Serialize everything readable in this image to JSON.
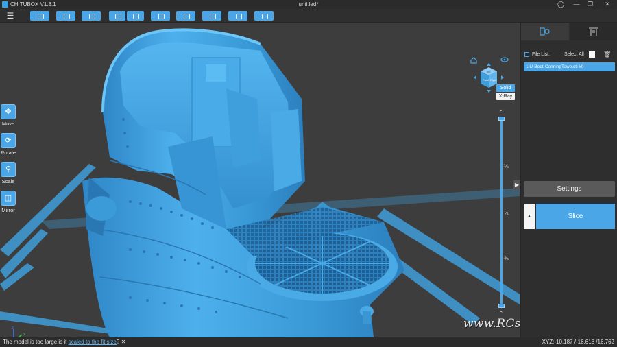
{
  "titlebar": {
    "app_name": "CHITUBOX V1.8.1",
    "document": "untitled*",
    "user_icon": "user-icon",
    "minimize_icon": "minimize-icon",
    "restore_icon": "restore-icon",
    "close_icon": "close-icon"
  },
  "toolbar": {
    "menu_icon": "hamburger-menu-icon",
    "buttons": [
      "open-file-icon",
      "save-file-dropdown-icon",
      "select-all-icon",
      "layout-left-icon",
      "layout-right-icon",
      "auto-layout-icon",
      "hollow-icon",
      "support-icon",
      "drill-hole-icon",
      "lock-icon"
    ]
  },
  "left_tools": [
    {
      "label": "Move",
      "icon": "move-icon"
    },
    {
      "label": "Rotate",
      "icon": "rotate-icon"
    },
    {
      "label": "Scale",
      "icon": "scale-icon"
    },
    {
      "label": "Mirror",
      "icon": "mirror-icon"
    }
  ],
  "view": {
    "modes": [
      "Solid",
      "X-Ray"
    ],
    "active_mode": "Solid",
    "cube_front": "Front",
    "cube_right": "Right",
    "cube_top": "Top"
  },
  "layer_slider": {
    "marks": [
      "¼",
      "½",
      "¾"
    ]
  },
  "watermark": "www.RCshipyard.com",
  "right_panel": {
    "tabs": [
      "print-settings-icon",
      "printer-icon"
    ],
    "file_list_label": "File List:",
    "select_all_label": "Select All",
    "files": [
      "1.U-Boot-ConningTowe.stl #0"
    ],
    "settings_label": "Settings",
    "slice_label": "Slice"
  },
  "status": {
    "message_prefix": "The model is too large,is it ",
    "message_link": "scaled to the fit size",
    "message_suffix": "?",
    "coords": "XYZ:-10.187 /-16.618 /16.762"
  },
  "colors": {
    "accent": "#4aa6e6",
    "background": "#3d3d3d",
    "panel": "#2e2e2e",
    "model": "#3d9fde"
  }
}
